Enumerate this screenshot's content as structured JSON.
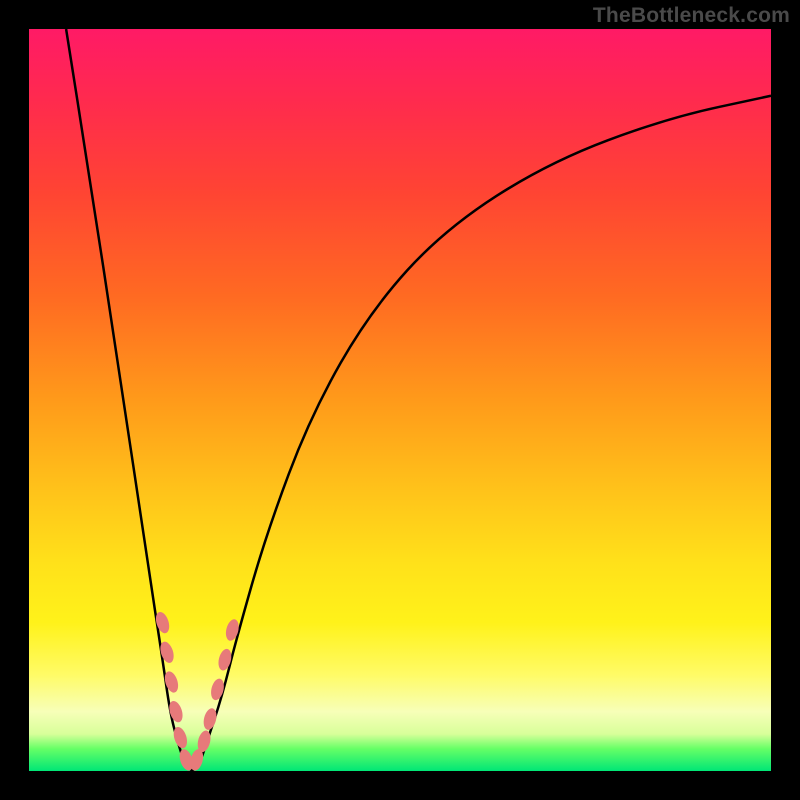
{
  "watermark": "TheBottleneck.com",
  "chart_data": {
    "type": "line",
    "title": "",
    "xlabel": "",
    "ylabel": "",
    "xlim": [
      0,
      100
    ],
    "ylim": [
      0,
      100
    ],
    "legend": false,
    "grid": false,
    "series": [
      {
        "name": "left-branch",
        "x": [
          5,
          8,
          12,
          16,
          18,
          19,
          20,
          21,
          22
        ],
        "y": [
          100,
          81,
          55,
          28,
          15,
          8,
          4,
          1,
          0
        ]
      },
      {
        "name": "right-branch",
        "x": [
          22,
          23,
          24,
          26,
          28,
          32,
          38,
          46,
          56,
          70,
          86,
          100
        ],
        "y": [
          0,
          1,
          4,
          10,
          18,
          32,
          48,
          62,
          73,
          82,
          88,
          91
        ]
      }
    ],
    "markers": [
      {
        "series": "left-branch",
        "x": 18.0,
        "y": 20.0
      },
      {
        "series": "left-branch",
        "x": 18.6,
        "y": 16.0
      },
      {
        "series": "left-branch",
        "x": 19.2,
        "y": 12.0
      },
      {
        "series": "left-branch",
        "x": 19.8,
        "y": 8.0
      },
      {
        "series": "left-branch",
        "x": 20.4,
        "y": 4.5
      },
      {
        "series": "left-branch",
        "x": 21.2,
        "y": 1.5
      },
      {
        "series": "right-branch",
        "x": 22.6,
        "y": 1.5
      },
      {
        "series": "right-branch",
        "x": 23.6,
        "y": 4.0
      },
      {
        "series": "right-branch",
        "x": 24.4,
        "y": 7.0
      },
      {
        "series": "right-branch",
        "x": 25.4,
        "y": 11.0
      },
      {
        "series": "right-branch",
        "x": 26.4,
        "y": 15.0
      },
      {
        "series": "right-branch",
        "x": 27.4,
        "y": 19.0
      }
    ],
    "colors": {
      "curve": "#000000",
      "marker_fill": "#e77a7a",
      "marker_stroke": "#9c3a3a"
    },
    "background_gradient_note": "vertical, magenta-red at top through orange/yellow to thin green band at bottom"
  }
}
